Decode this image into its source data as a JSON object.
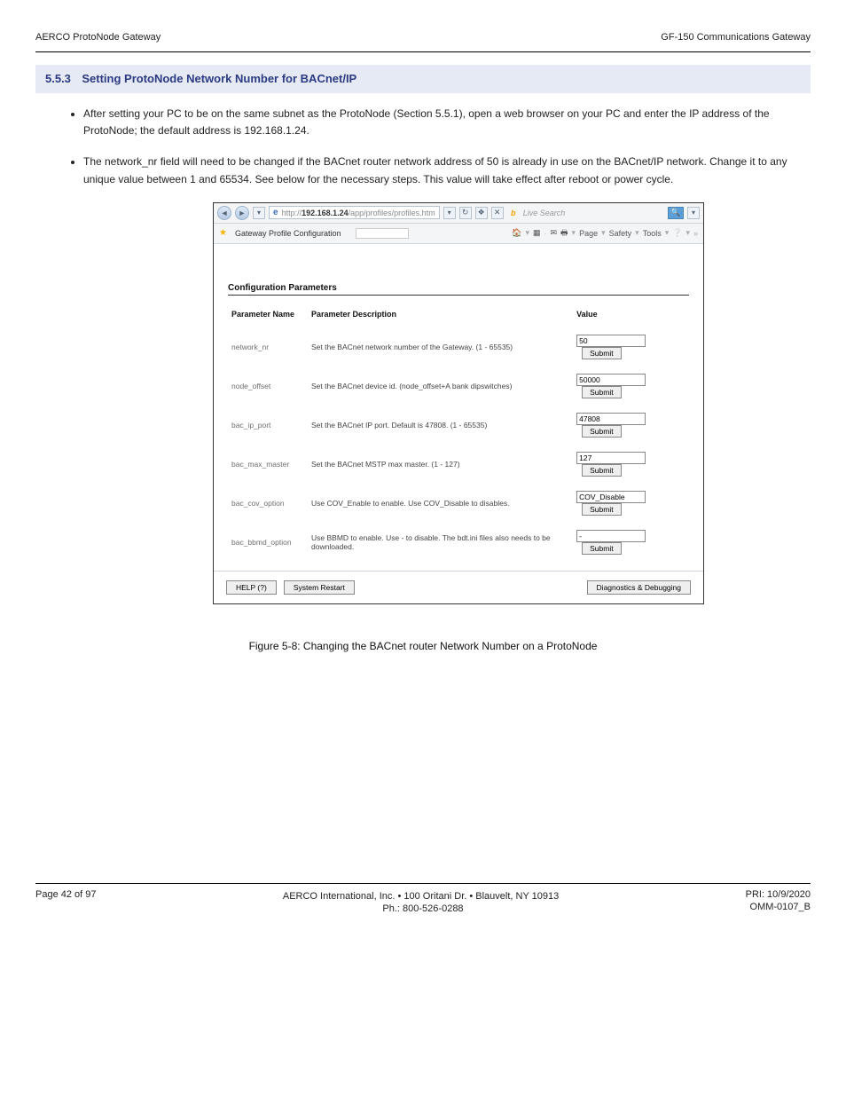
{
  "header": {
    "left": "AERCO ProtoNode Gateway",
    "right": "GF-150 Communications Gateway"
  },
  "section": {
    "number": "5.5.3",
    "title": "Setting ProtoNode Network Number for BACnet/IP"
  },
  "bullets": [
    "After setting your PC to be on the same subnet as the ProtoNode (Section 5.5.1), open a web browser on your PC and enter the IP address of the ProtoNode; the default address is 192.168.1.24.",
    "The network_nr field will need to be changed if the BACnet router network address of 50 is already in use on the BACnet/IP network. Change it to any unique value between 1 and 65534. See below for the necessary steps. This value will take effect after reboot or power cycle."
  ],
  "browser": {
    "url_prefix": "http://",
    "url_host": "192.168.1.24",
    "url_path": "/app/profiles/profiles.htm",
    "search_placeholder": "Live Search",
    "tab_title": "Gateway Profile Configuration",
    "toolbar": [
      "Page",
      "Safety",
      "Tools"
    ]
  },
  "config": {
    "section_title": "Configuration Parameters",
    "columns": [
      "Parameter Name",
      "Parameter Description",
      "Value"
    ],
    "rows": [
      {
        "name": "network_nr",
        "desc": "Set the BACnet network number of the Gateway. (1 - 65535)",
        "value": "50"
      },
      {
        "name": "node_offset",
        "desc": "Set the BACnet device id. (node_offset+A bank dipswitches)",
        "value": "50000"
      },
      {
        "name": "bac_ip_port",
        "desc": "Set the BACnet IP port. Default is 47808. (1 - 65535)",
        "value": "47808"
      },
      {
        "name": "bac_max_master",
        "desc": "Set the BACnet MSTP max master. (1 - 127)",
        "value": "127"
      },
      {
        "name": "bac_cov_option",
        "desc": "Use COV_Enable to enable. Use COV_Disable to disables.",
        "value": "COV_Disable"
      },
      {
        "name": "bac_bbmd_option",
        "desc": "Use BBMD to enable. Use - to disable. The bdt.ini files also needs to be downloaded.",
        "value": "-"
      }
    ],
    "submit_label": "Submit",
    "buttons": {
      "help": "HELP (?)",
      "restart": "System Restart",
      "diag": "Diagnostics & Debugging"
    }
  },
  "figure_caption": "Figure 5-8: Changing the BACnet router Network Number on a ProtoNode",
  "footer": {
    "left": "Page 42 of 97",
    "right_1": "PRI: 10/9/2020",
    "right_2": "OMM-0107_B",
    "center_1": "AERCO International, Inc. • 100 Oritani Dr. • Blauvelt, NY 10913",
    "center_2": "Ph.: 800-526-0288"
  }
}
